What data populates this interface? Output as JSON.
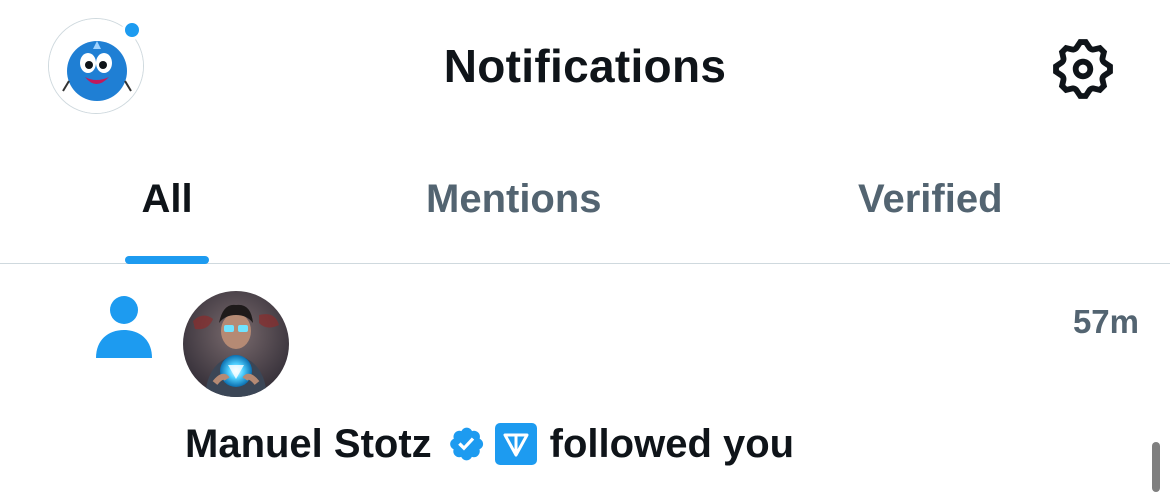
{
  "header": {
    "title": "Notifications",
    "profile_icon": "user-avatar-icon",
    "settings_icon": "gear-icon"
  },
  "tabs": [
    {
      "label": "All",
      "active": true
    },
    {
      "label": "Mentions",
      "active": false
    },
    {
      "label": "Verified",
      "active": false
    }
  ],
  "notification": {
    "type_icon": "person-icon",
    "user_name": "Manuel Stotz",
    "verified_icon": "verified-badge-icon",
    "affiliate_icon": "ton-logo-icon",
    "action_text": "followed you",
    "time": "57m"
  },
  "colors": {
    "accent": "#1d9bf0",
    "text_primary": "#0f1419",
    "text_secondary": "#536471",
    "divider": "#cfd9de"
  }
}
